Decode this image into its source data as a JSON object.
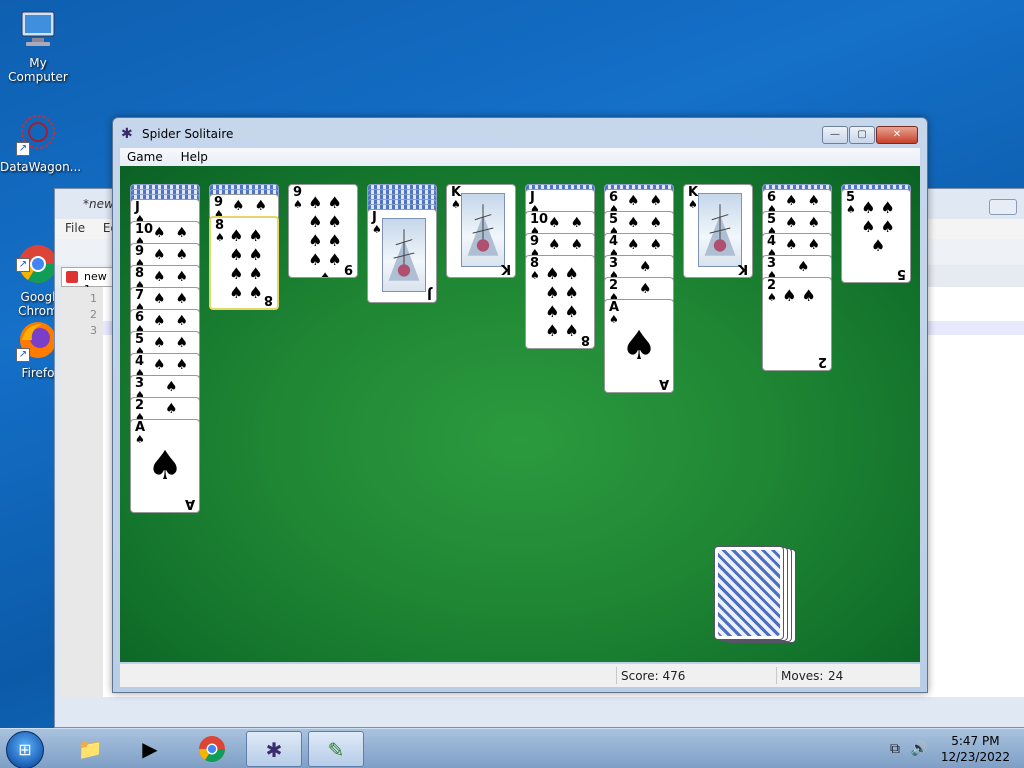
{
  "desktop": {
    "icons": [
      {
        "label": "My Computer"
      },
      {
        "label": "DataWagon..."
      },
      {
        "label": "Googl\nChrom"
      },
      {
        "label": "Firefo"
      }
    ]
  },
  "background_window": {
    "title": "*new",
    "menu": [
      "File",
      "Ed"
    ],
    "tab_label": "new 1",
    "line_numbers": [
      "1",
      "2",
      "3"
    ]
  },
  "window": {
    "title": "Spider Solitaire",
    "menu": {
      "game": "Game",
      "help": "Help"
    },
    "controls": {
      "minimize": "—",
      "maximize": "▢",
      "close": "✕"
    }
  },
  "status": {
    "score_label": "Score: 476",
    "moves_label": "Moves:",
    "moves_value": "24"
  },
  "tableau": [
    {
      "backs": 3,
      "cards": [
        "J",
        "10",
        "9",
        "8",
        "7",
        "6",
        "5",
        "4",
        "3",
        "2",
        "A"
      ]
    },
    {
      "backs": 2,
      "cards": [
        "9",
        "8"
      ],
      "selected": "8"
    },
    {
      "backs": 0,
      "cards": [
        "9"
      ]
    },
    {
      "backs": 5,
      "cards": [
        "J"
      ]
    },
    {
      "backs": 0,
      "cards": [
        "K"
      ]
    },
    {
      "backs": 1,
      "cards": [
        "J",
        "10",
        "9",
        "8"
      ]
    },
    {
      "backs": 1,
      "cards": [
        "6",
        "5",
        "4",
        "3",
        "2",
        "A"
      ]
    },
    {
      "backs": 0,
      "cards": [
        "K"
      ]
    },
    {
      "backs": 1,
      "cards": [
        "6",
        "5",
        "4",
        "3",
        "2"
      ]
    },
    {
      "backs": 1,
      "cards": [
        "5"
      ]
    }
  ],
  "suit_symbol": "♠",
  "stock": {
    "piles": 4
  },
  "taskbar": {
    "clock_time": "5:47 PM",
    "clock_date": "12/23/2022"
  },
  "colors": {
    "felt": "#1f8634",
    "card_back": "#4f74c3",
    "selection": "#e6d66a"
  }
}
